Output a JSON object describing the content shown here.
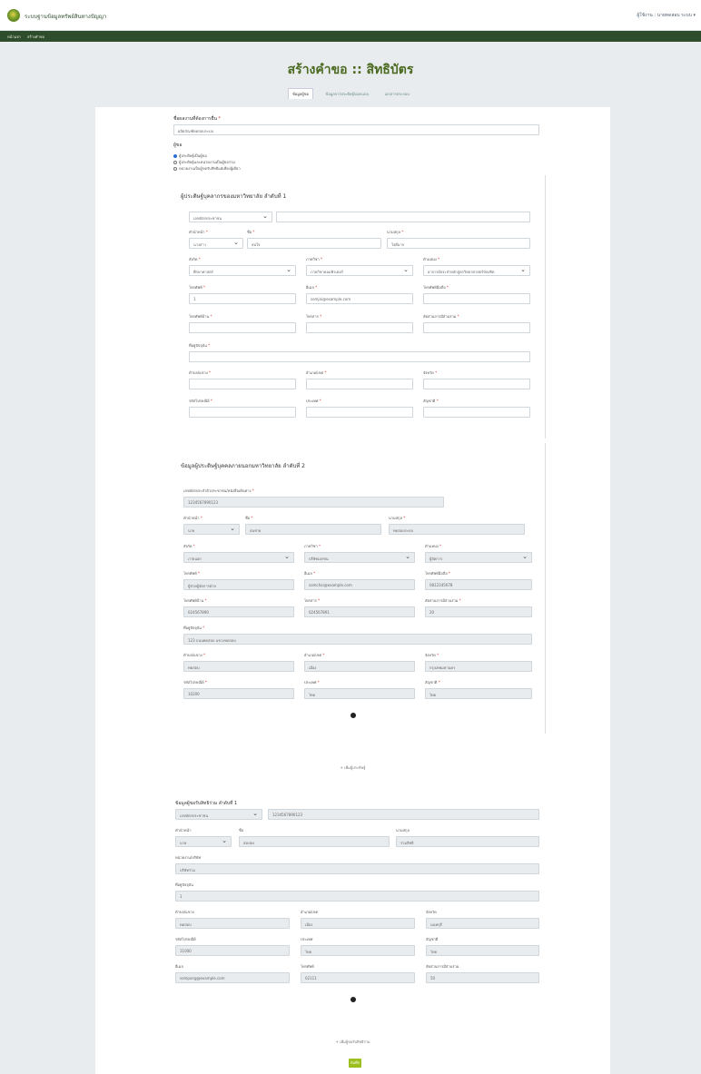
{
  "header": {
    "site_title": "ระบบฐานข้อมูลทรัพย์สินทางปัญญา",
    "user_info": "ผู้ใช้งาน : นายทดสอบ ระบบ ▾"
  },
  "nav": {
    "items": [
      "หน้าแรก",
      "สร้างคำขอ"
    ]
  },
  "page": {
    "title": "สร้างคำขอ :: สิทธิบัตร"
  },
  "tabs": [
    "ข้อมูลผู้ขอ",
    "ข้อมูลการประดิษฐ์/ออกแบบ",
    "เอกสารประกอบ"
  ],
  "form": {
    "request_name_label": "ชื่อผลงานที่ต้องการยื่น",
    "request_name_value": "ผลิตภัณฑ์ทดสอบระบบ",
    "applicant_type_label": "ผู้ขอ",
    "radio_options": [
      "ผู้ประดิษฐ์เป็นผู้ขอ",
      "ผู้ประดิษฐ์และหน่วยงานเป็นผู้ขอร่วม",
      "หน่วยงานเป็นผู้ขอรับสิทธิแต่เพียงผู้เดียว"
    ],
    "inventor1": {
      "heading": "ผู้ประดิษฐ์บุคลากรของมหาวิทยาลัย ลำดับที่ 1",
      "id_type": "เลขบัตรประชาชน",
      "id_value": "",
      "prefix_label": "คำนำหน้า",
      "prefix_value": "นางสาว",
      "firstname_label": "ชื่อ",
      "firstname_value": "สมใจ",
      "lastname_label": "นามสกุล",
      "lastname_value": "ใจดีมาก",
      "faculty_label": "สังกัด",
      "faculty_value": "ศึกษาศาสตร์",
      "dept_label": "ภาควิชา",
      "dept_value": "ภาควิชาคอมพิวเตอร์",
      "position_label": "ตำแหน่ง",
      "position_value": "อาจารย์ประจำหลักสูตรวิทยาศาสตร์บัณฑิต",
      "work_phone_label": "โทรศัพท์",
      "work_phone_value": "1",
      "email_label": "อีเมล",
      "email_value": "somjai@example.com",
      "mobile_label": "โทรศัพท์มือถือ",
      "mobile_value": "",
      "home_phone_label": "โทรศัพท์บ้าน",
      "home_phone_value": "",
      "fax_label": "โทรสาร",
      "fax_value": "",
      "share_label": "สัดส่วนการมีส่วนร่วม",
      "share_value": "",
      "address_label": "ที่อยู่ปัจจุบัน",
      "address_value": "",
      "subdistrict_label": "ตำบล/แขวง",
      "subdistrict_value": "",
      "district_label": "อำเภอ/เขต",
      "district_value": "",
      "province_label": "จังหวัด",
      "province_value": "",
      "postcode_label": "รหัสไปรษณีย์",
      "postcode_value": "",
      "country_label": "ประเทศ",
      "country_value": "",
      "nationality_label": "สัญชาติ",
      "nationality_value": ""
    },
    "inventor2": {
      "heading": "ข้อมูลผู้ประดิษฐ์บุคคลภายนอกมหาวิทยาลัย ลำดับที่ 2",
      "id_label": "เลขบัตรประจำตัวประชาชน/หนังสือเดินทาง",
      "id_value": "1234567890123",
      "prefix_label": "คำนำหน้า",
      "prefix_value": "นาย",
      "firstname_label": "ชื่อ",
      "firstname_value": "สมชาย",
      "lastname_label": "นามสกุล",
      "lastname_value": "ทดสอบระบบ",
      "faculty_label": "สังกัด",
      "faculty_value": "ภายนอก",
      "dept_label": "ภาควิชา",
      "dept_value": "บริษัทเอกชน",
      "position_label": "ตำแหน่ง",
      "position_value": "ผู้จัดการ",
      "phone_label": "โทรศัพท์",
      "phone_value": "ผู้ช่วยผู้จัดการฝ่าย",
      "email_label": "อีเมล",
      "email_value": "somchai@example.com",
      "mobile_label": "โทรศัพท์มือถือ",
      "mobile_value": "0812345678",
      "home_label": "โทรศัพท์บ้าน",
      "home_value": "024567890",
      "fax_label": "โทรสาร",
      "fax_value": "024567891",
      "share_label": "สัดส่วนการมีส่วนร่วม",
      "share_value": "20",
      "address_label": "ที่อยู่ปัจจุบัน",
      "address_value": "123 ถนนทดสอบ แขวงทดสอบ",
      "subdistrict_label": "ตำบล/แขวง",
      "subdistrict_value": "ทดสอบ",
      "district_label": "อำเภอ/เขต",
      "district_value": "เมือง",
      "province_label": "จังหวัด",
      "province_value": "กรุงเทพมหานคร",
      "postcode_label": "รหัสไปรษณีย์",
      "postcode_value": "10200",
      "country_label": "ประเทศ",
      "country_value": "ไทย",
      "nationality_label": "สัญชาติ",
      "nationality_value": "ไทย"
    },
    "add_inventor_link": "+ เพิ่มผู้ประดิษฐ์",
    "coapplicant": {
      "heading": "ข้อมูลผู้ขอรับสิทธิร่วม ลำดับที่ 1",
      "id_type": "เลขบัตรประชาชน",
      "id_value": "1234567890123",
      "prefix_label": "คำนำหน้า",
      "prefix_value": "นาย",
      "firstname_label": "ชื่อ",
      "firstname_value": "สมปอง",
      "lastname_label": "นามสกุล",
      "lastname_value": "ร่วมสิทธิ",
      "org_label": "หน่วยงาน/บริษัท",
      "org_value": "บริษัทร่วม",
      "address_label": "ที่อยู่ปัจจุบัน",
      "address_value": "1",
      "subdistrict_label": "ตำบล/แขวง",
      "subdistrict_value": "ทดสอบ",
      "district_label": "อำเภอ/เขต",
      "district_value": "เมือง",
      "province_label": "จังหวัด",
      "province_value": "นนทบุรี",
      "postcode_label": "รหัสไปรษณีย์",
      "postcode_value": "11000",
      "country_label": "ประเทศ",
      "country_value": "ไทย",
      "nationality_label": "สัญชาติ",
      "nationality_value": "ไทย",
      "email_label": "อีเมล",
      "email_value": "sompong@example.com",
      "phone_label": "โทรศัพท์",
      "phone_value": "02111",
      "share_label": "สัดส่วนการมีส่วนร่วม",
      "share_value": "50"
    },
    "add_coapplicant_link": "+ เพิ่มผู้ขอรับสิทธิร่วม",
    "save_button": "บันทึก"
  }
}
